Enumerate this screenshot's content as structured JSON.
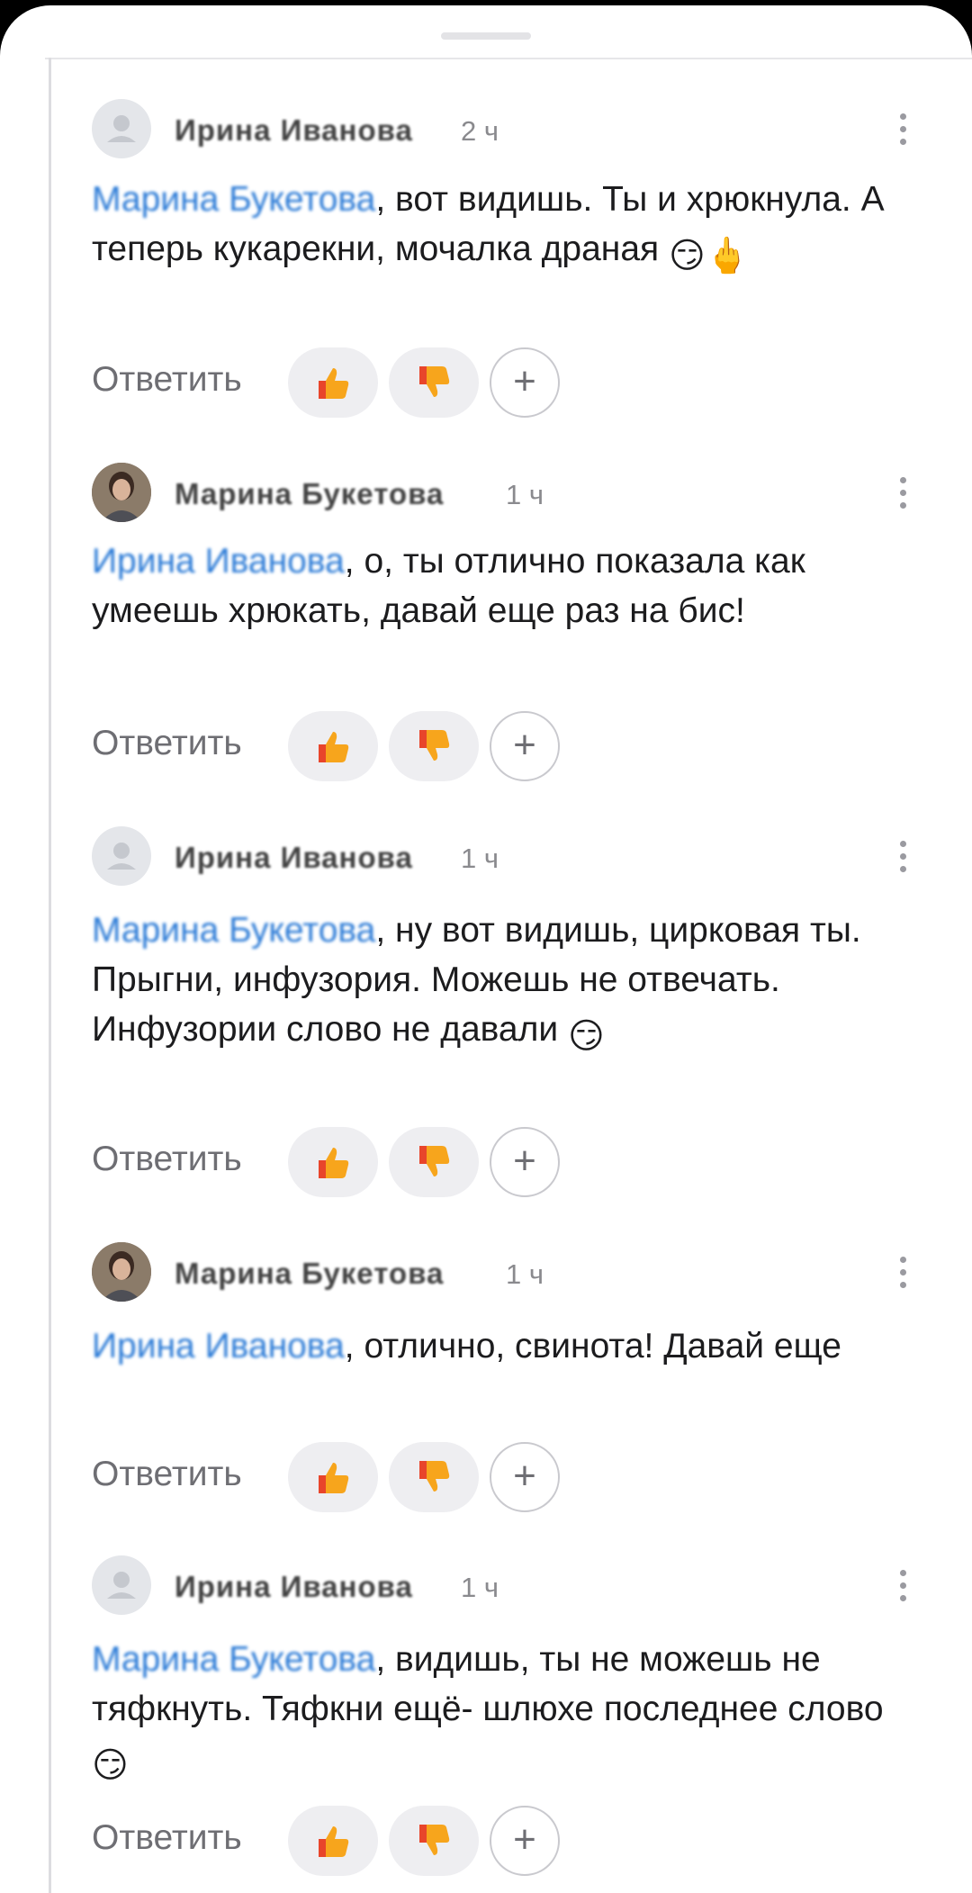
{
  "comments": [
    {
      "author": "Ирина Иванова",
      "time": "2 ч",
      "mention": "Марина Букетова",
      "text": ", вот видишь. Ты и хрюкнула. А теперь кукарекни, мочалка драная",
      "emoji": "😏🖕",
      "reply": "Ответить"
    },
    {
      "author": "Марина Букетова",
      "time": "1 ч",
      "mention": "Ирина Иванова",
      "text": ", о, ты отлично показала как умеешь хрюкать, давай еще раз на бис!",
      "emoji": "",
      "reply": "Ответить"
    },
    {
      "author": "Ирина Иванова",
      "time": "1 ч",
      "mention": "Марина Букетова",
      "text": ", ну вот видишь, цирковая ты. Прыгни, инфузория. Можешь не отвечать. Инфузории слово не давали",
      "emoji": "😏",
      "reply": "Ответить"
    },
    {
      "author": "Марина Букетова",
      "time": "1 ч",
      "mention": "Ирина Иванова",
      "text": ", отлично, свинота! Давай еще",
      "emoji": "",
      "reply": "Ответить"
    },
    {
      "author": "Ирина Иванова",
      "time": "1 ч",
      "mention": "Марина Букетова",
      "text": ", видишь, ты не можешь не тяфкнуть. Тяфкни ещё- шлюхе последнее слово",
      "emoji": "😏",
      "reply": "Ответить"
    }
  ],
  "reactions": {
    "like_icon": "thumbs-up-icon",
    "dislike_icon": "thumbs-down-icon",
    "add_icon": "plus-icon",
    "add_label": "+"
  },
  "colors": {
    "mention": "#2a7ad6",
    "text": "#1c1c1e",
    "secondary": "#6e6e73"
  }
}
